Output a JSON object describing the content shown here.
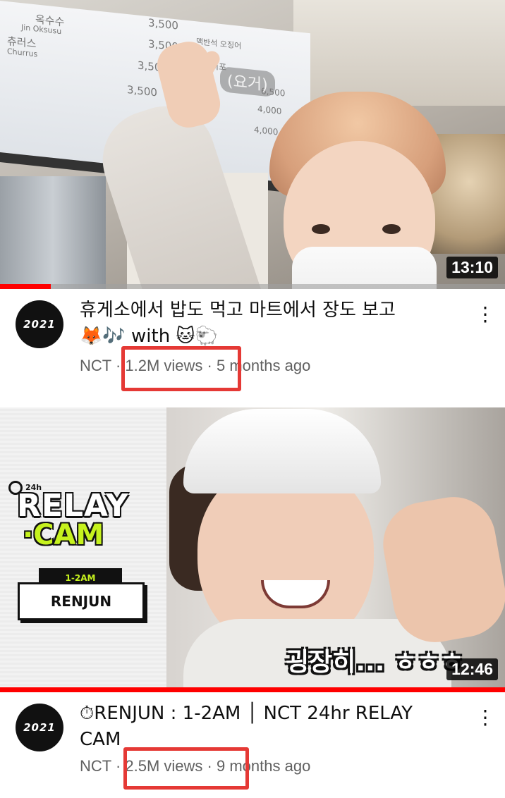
{
  "videos": [
    {
      "duration": "13:10",
      "progress_percent": 10,
      "avatar_text": "2021",
      "title_line1": "휴게소에서 밥도 먹고 마트에서 장도 보고",
      "title_line2": "🦊🎶 with 🐱🐑",
      "channel": "NCT",
      "views": "1.2M views",
      "age": "5 months ago",
      "thumbnail_text": {
        "menu_items": [
          "옥수수",
          "Jin Oksusu",
          "츄러스",
          "Churrus",
          "3,500",
          "3,500",
          "3,500",
          "3,500",
          "맥반석 오징어",
          "쥐치포",
          "6,500",
          "4,000",
          "4,000"
        ],
        "highlight": "(요거)"
      }
    },
    {
      "duration": "12:46",
      "progress_percent": 100,
      "avatar_text": "2021",
      "title_line1": "⏱RENJUN : 1-2AM │ NCT 24hr RELAY",
      "title_line2": "CAM",
      "channel": "NCT",
      "views": "2.5M views",
      "age": "9 months ago",
      "thumbnail_text": {
        "badge": "24h",
        "relay": "RELAY",
        "cam": "·CAM",
        "time": "1-2AM",
        "name": "RENJUN",
        "subtitle": "굉장히... ㅎㅎㅎ"
      }
    }
  ],
  "separator": " · ",
  "colors": {
    "progress": "#ff0000",
    "highlight_box": "#e53935",
    "secondary_text": "#606060"
  }
}
